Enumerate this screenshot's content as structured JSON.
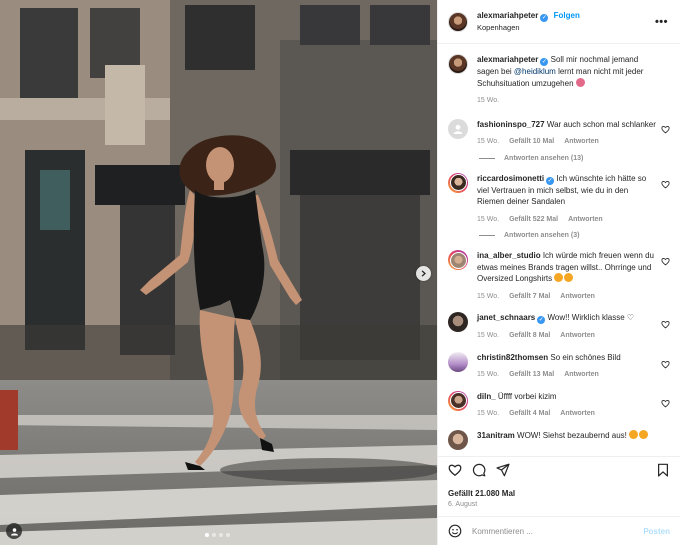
{
  "post": {
    "author": "alexmariahpeter",
    "follow_label": "Folgen",
    "location": "Kopenhagen",
    "more_label": "•••"
  },
  "caption": {
    "user": "alexmariahpeter",
    "text_before": "Soll mir nochmal jemand sagen bei ",
    "mention": "@heidiklum",
    "text_after": " lernt man nicht mit jeder Schuhsituation umzugehen ",
    "time": "15 Wo."
  },
  "comments": [
    {
      "user": "fashioninspo_727",
      "text": "War auch schon mal schlanker",
      "time": "15 Wo.",
      "likes": "Gefällt 10 Mal",
      "reply": "Antworten",
      "replies": "Antworten ansehen (13)"
    },
    {
      "user": "riccardosimonetti",
      "text": "Ich wünschte ich hätte so viel Vertrauen in mich selbst, wie du in den Riemen deiner Sandalen",
      "time": "15 Wo.",
      "likes": "Gefällt 522 Mal",
      "reply": "Antworten",
      "replies": "Antworten ansehen (3)"
    },
    {
      "user": "ina_alber_studio",
      "text": "Ich würde mich freuen wenn du etwas meines Brands tragen willst.. Ohrringe und Oversized Longshirts ",
      "time": "15 Wo.",
      "likes": "Gefällt 7 Mal",
      "reply": "Antworten"
    },
    {
      "user": "janet_schnaars",
      "text": "Wow!! Wirklich klasse ♡",
      "time": "15 Wo.",
      "likes": "Gefällt 8 Mal",
      "reply": "Antworten"
    },
    {
      "user": "christin82thomsen",
      "text": "So ein schönes Bild",
      "time": "15 Wo.",
      "likes": "Gefällt 13 Mal",
      "reply": "Antworten"
    },
    {
      "user": "diln_",
      "text": "Üffff vorbei kizim",
      "time": "15 Wo.",
      "likes": "Gefällt 4 Mal",
      "reply": "Antworten"
    },
    {
      "user": "31anitram",
      "text": "WOW! Siehst bezaubernd aus! "
    }
  ],
  "footer": {
    "likes": "Gefällt 21.080 Mal",
    "date": "6. August"
  },
  "composer": {
    "placeholder": "Kommentieren ...",
    "post_label": "Posten"
  },
  "colors": {
    "accent": "#0095f6",
    "verified": "#3897f0",
    "muted": "#8e8e8e"
  },
  "carousel": {
    "dots": 4,
    "active": 1
  }
}
